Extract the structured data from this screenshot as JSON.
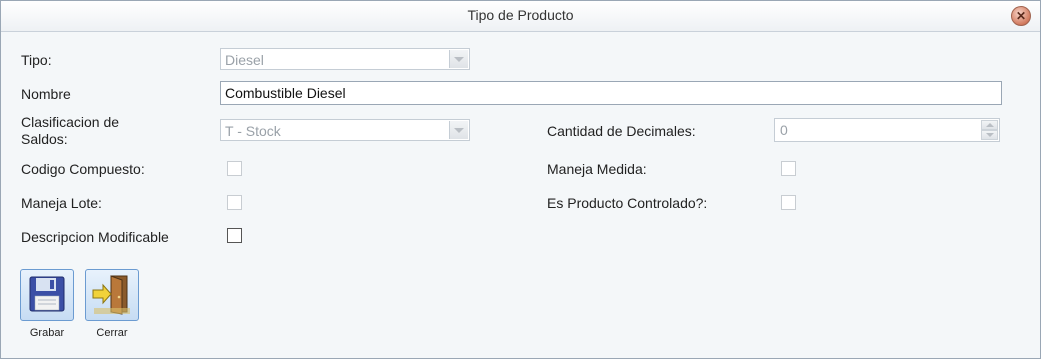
{
  "window": {
    "title": "Tipo de Producto"
  },
  "form": {
    "tipo": {
      "label": "Tipo:",
      "value": "Diesel"
    },
    "nombre": {
      "label": "Nombre",
      "value": "Combustible Diesel"
    },
    "clasificacion": {
      "label_line1": "Clasificacion de",
      "label_line2": "Saldos:",
      "value": "T - Stock"
    },
    "cantidad_decimales": {
      "label": "Cantidad de Decimales:",
      "value": "0"
    },
    "codigo_compuesto": {
      "label": "Codigo Compuesto:"
    },
    "maneja_medida": {
      "label": "Maneja Medida:"
    },
    "maneja_lote": {
      "label": "Maneja Lote:"
    },
    "es_producto_controlado": {
      "label": "Es Producto Controlado?:"
    },
    "descripcion_modificable": {
      "label": "Descripcion Modificable"
    }
  },
  "buttons": {
    "grabar": "Grabar",
    "cerrar": "Cerrar"
  },
  "icons": {
    "close": "close-icon",
    "grabar": "floppy-disk-icon",
    "cerrar": "exit-door-icon"
  },
  "colors": {
    "accent": "#6b9bd1",
    "close": "#d27a5e"
  }
}
